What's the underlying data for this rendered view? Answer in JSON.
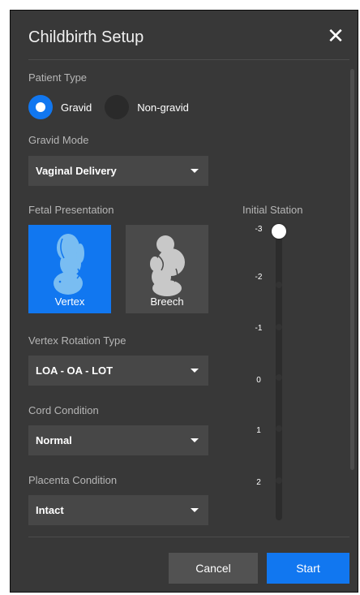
{
  "dialog": {
    "title": "Childbirth Setup",
    "close_icon": "close-icon"
  },
  "patient_type": {
    "label": "Patient Type",
    "options": [
      {
        "label": "Gravid",
        "selected": true
      },
      {
        "label": "Non-gravid",
        "selected": false
      }
    ]
  },
  "gravid_mode": {
    "label": "Gravid Mode",
    "value": "Vaginal Delivery"
  },
  "fetal_presentation": {
    "label": "Fetal Presentation",
    "options": [
      {
        "label": "Vertex",
        "selected": true,
        "icon": "fetus-vertex-icon"
      },
      {
        "label": "Breech",
        "selected": false,
        "icon": "fetus-breech-icon"
      }
    ]
  },
  "vertex_rotation": {
    "label": "Vertex Rotation Type",
    "value": "LOA - OA - LOT"
  },
  "cord_condition": {
    "label": "Cord Condition",
    "value": "Normal"
  },
  "placenta_condition": {
    "label": "Placenta Condition",
    "value": "Intact"
  },
  "initial_station": {
    "label": "Initial Station",
    "ticks": [
      "-3",
      "-2",
      "-1",
      "0",
      "1",
      "2"
    ],
    "value": -3
  },
  "buttons": {
    "cancel": "Cancel",
    "start": "Start"
  },
  "colors": {
    "accent": "#1177f0",
    "panel": "#383838",
    "control": "#474747"
  }
}
